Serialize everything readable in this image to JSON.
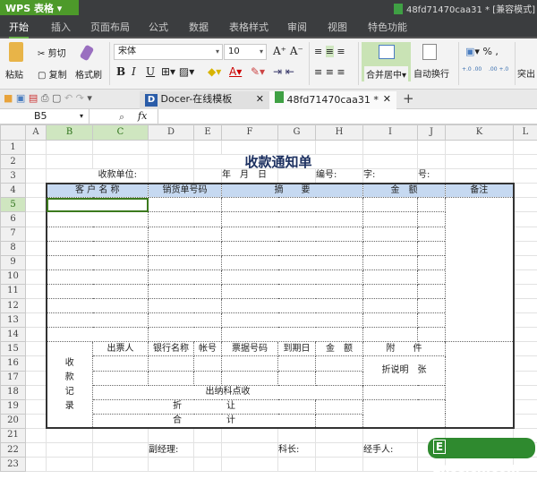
{
  "app": {
    "name": "WPS 表格",
    "doc_title": "48fd71470caa31 * [兼容模式]"
  },
  "menu": [
    "开始",
    "插入",
    "页面布局",
    "公式",
    "数据",
    "表格样式",
    "审阅",
    "视图",
    "特色功能"
  ],
  "ribbon": {
    "paste": "粘贴",
    "cut": "剪切",
    "copy": "复制",
    "format_painter": "格式刷",
    "font": "宋体",
    "font_size": "10",
    "bold": "B",
    "italic": "I",
    "underline": "U",
    "merge_center": "合并居中",
    "wrap_text": "自动换行",
    "percent": "%",
    "comma": ",",
    "inc_decimal": "+.0 .00",
    "dec_decimal": ".00 +.0",
    "more": "突出"
  },
  "tabs": [
    {
      "label": "Docer-在线模板"
    },
    {
      "label": "48fd71470caa31 *"
    }
  ],
  "formula_bar": {
    "name_box": "B5",
    "fx": "fx",
    "value": ""
  },
  "grid": {
    "columns": [
      "A",
      "B",
      "C",
      "D",
      "E",
      "F",
      "G",
      "H",
      "I",
      "J",
      "K",
      "L"
    ],
    "rows": [
      "1",
      "2",
      "3",
      "4",
      "5",
      "6",
      "7",
      "8",
      "9",
      "10",
      "11",
      "12",
      "13",
      "14",
      "15",
      "16",
      "17",
      "18",
      "19",
      "20",
      "21",
      "22",
      "23"
    ],
    "selected_cell": "B5"
  },
  "form": {
    "title": "收款通知单",
    "payer_unit": "收款单位:",
    "date": "年　月　日",
    "number": "编号:",
    "zi": "字:",
    "hao": "号:",
    "headers": [
      "客 户 名 称",
      "销货单号码",
      "摘　　要",
      "金　额",
      "备注"
    ],
    "record_label": "收款记录",
    "record_headers": [
      "出票人",
      "银行名称",
      "帐号",
      "票据号码",
      "到期日",
      "金　额",
      "附　　件"
    ],
    "attach_note": "折说明　张",
    "cashier": "出纳科点收",
    "discount": "折　　　　　让",
    "total": "合　　　　　计",
    "manager": "副经理:",
    "section_chief": "科长:",
    "handler": "经手人:"
  },
  "watermark": "Excelcn.com",
  "colors": {
    "header_fill": "#c6d9f1",
    "app_green": "#4d9a2a",
    "selection": "#3c7a1e"
  }
}
